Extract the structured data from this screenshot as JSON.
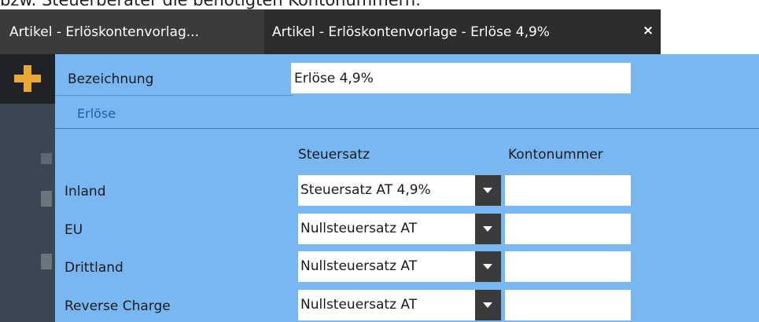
{
  "top_text": "bzw. Steuerberater die benötigten Kontonummern.",
  "tabs": [
    {
      "label": "Artikel - Erlöskontenvorlag..."
    },
    {
      "label": "Artikel - Erlöskontenvorlage - Erlöse 4,9%",
      "close": "×"
    }
  ],
  "form": {
    "bezeichnung_label": "Bezeichnung",
    "bezeichnung_value": "Erlöse 4,9%",
    "section_title": "Erlöse",
    "col_steuersatz": "Steuersatz",
    "col_kontonummer": "Kontonummer",
    "rows": [
      {
        "label": "Inland",
        "steuersatz": "Steuersatz AT 4,9%",
        "kontonummer": ""
      },
      {
        "label": "EU",
        "steuersatz": "Nullsteuersatz AT",
        "kontonummer": ""
      },
      {
        "label": "Drittland",
        "steuersatz": "Nullsteuersatz AT",
        "kontonummer": ""
      },
      {
        "label": "Reverse Charge",
        "steuersatz": "Nullsteuersatz AT",
        "kontonummer": ""
      }
    ]
  },
  "colors": {
    "panel": "#79b7f2",
    "tab_active": "#2d2d2d",
    "tab_inactive": "#3b3b3b",
    "accent_plus": "#e8a832",
    "section_title": "#1e5ea8"
  },
  "icons": {
    "new": "plus-icon",
    "close": "close-icon",
    "dropdown": "chevron-down-icon"
  }
}
